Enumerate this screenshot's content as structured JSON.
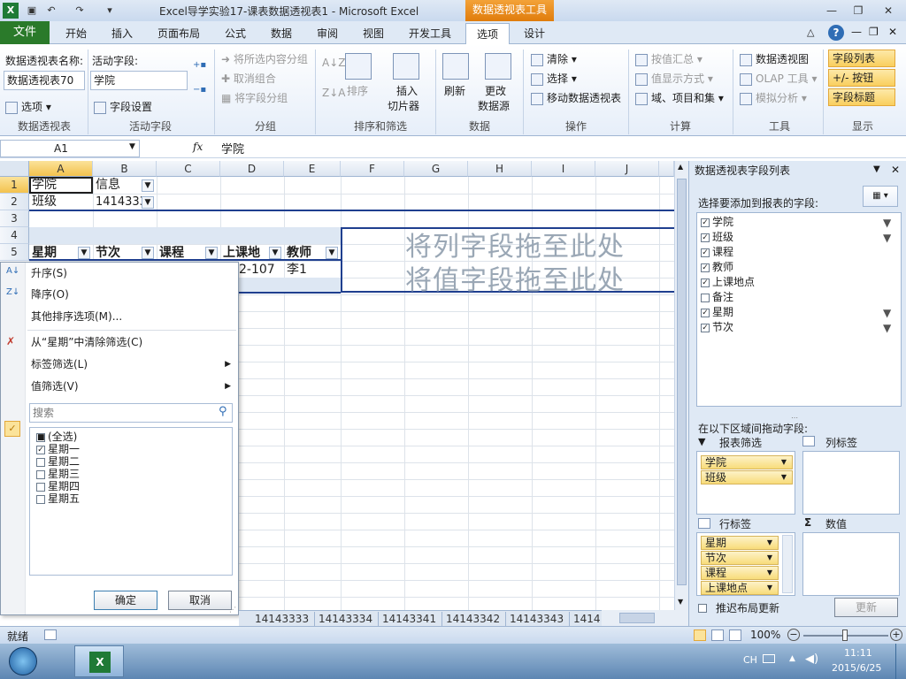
{
  "window": {
    "title": "Excel导学实验17-课表数据透视表1  -  Microsoft Excel",
    "context_tab_header": "数据透视表工具"
  },
  "tabs": {
    "file": "文件",
    "items": [
      "开始",
      "插入",
      "页面布局",
      "公式",
      "数据",
      "审阅",
      "视图",
      "开发工具",
      "选项",
      "设计"
    ]
  },
  "ribbon": {
    "pivot": {
      "name_label": "数据透视表名称:",
      "name_value": "数据透视表70",
      "options_btn": "选项",
      "group": "数据透视表"
    },
    "active_field": {
      "label": "活动字段:",
      "value": "学院",
      "settings_btn": "字段设置",
      "group": "活动字段"
    },
    "grouping": {
      "items": [
        "将所选内容分组",
        "取消组合",
        "将字段分组"
      ],
      "group": "分组"
    },
    "sort": {
      "sort_btn": "排序",
      "insert_slicer": "插入",
      "insert_slicer2": "切片器",
      "group": "排序和筛选"
    },
    "data": {
      "refresh": "刷新",
      "change_source": "更改",
      "change_source2": "数据源",
      "group": "数据"
    },
    "actions": {
      "clear": "清除",
      "select": "选择",
      "move": "移动数据透视表",
      "group": "操作"
    },
    "calc": {
      "summarize": "按值汇总",
      "show_as": "值显示方式",
      "fields_items": "域、项目和集",
      "group": "计算"
    },
    "tools": {
      "pivot_chart": "数据透视图",
      "olap": "OLAP 工具",
      "whatif": "模拟分析",
      "group": "工具"
    },
    "show": {
      "field_list": "字段列表",
      "buttons": "+/- 按钮",
      "headers": "字段标题",
      "group": "显示"
    }
  },
  "formula_bar": {
    "name_box": "A1",
    "fx": "fx",
    "content": "学院"
  },
  "grid": {
    "columns": [
      "A",
      "B",
      "C",
      "D",
      "E",
      "F",
      "G",
      "H",
      "I",
      "J"
    ],
    "rows": [
      "1",
      "2",
      "3",
      "4",
      "5"
    ],
    "cells": {
      "A1": "学院",
      "B1": "信息",
      "A2": "班级",
      "B2": "14143333",
      "A5": "星期",
      "B5": "节次",
      "C5": "课程",
      "D5": "上课地",
      "E5": "教师",
      "D6": "2-107",
      "E6": "李1"
    },
    "watermark_col": "将列字段拖至此处",
    "watermark_val": "将值字段拖至此处"
  },
  "filter_menu": {
    "sort_asc": "升序(S)",
    "sort_desc": "降序(O)",
    "more_sort": "其他排序选项(M)...",
    "clear_filter": "从“星期”中清除筛选(C)",
    "label_filter": "标签筛选(L)",
    "value_filter": "值筛选(V)",
    "search_placeholder": "搜索",
    "items": [
      {
        "label": "(全选)",
        "state": "mixed"
      },
      {
        "label": "星期一",
        "state": "checked"
      },
      {
        "label": "星期二",
        "state": "unchecked"
      },
      {
        "label": "星期三",
        "state": "unchecked"
      },
      {
        "label": "星期四",
        "state": "unchecked"
      },
      {
        "label": "星期五",
        "state": "unchecked"
      }
    ],
    "ok": "确定",
    "cancel": "取消"
  },
  "sheet_tabs": [
    "14143333",
    "14143334",
    "14143341",
    "14143342",
    "14143343",
    "1414"
  ],
  "status": {
    "ready": "就绪",
    "zoom": "100%"
  },
  "pane": {
    "title": "数据透视表字段列表",
    "choose_label": "选择要添加到报表的字段:",
    "fields": [
      {
        "label": "学院",
        "checked": true,
        "filtered": true
      },
      {
        "label": "班级",
        "checked": true,
        "filtered": true
      },
      {
        "label": "课程",
        "checked": true,
        "filtered": false
      },
      {
        "label": "教师",
        "checked": true,
        "filtered": false
      },
      {
        "label": "上课地点",
        "checked": true,
        "filtered": false
      },
      {
        "label": "备注",
        "checked": false,
        "filtered": false
      },
      {
        "label": "星期",
        "checked": true,
        "filtered": true
      },
      {
        "label": "节次",
        "checked": true,
        "filtered": true
      }
    ],
    "drag_label": "在以下区域间拖动字段:",
    "report_filter": "报表筛选",
    "column_labels": "列标签",
    "row_labels": "行标签",
    "values": "数值",
    "filter_chips": [
      "学院",
      "班级"
    ],
    "row_chips": [
      "星期",
      "节次",
      "课程",
      "上课地点"
    ],
    "defer_label": "推迟布局更新",
    "update_btn": "更新"
  },
  "taskbar": {
    "lang": "CH",
    "time": "11:11",
    "date": "2015/6/25"
  },
  "colors": {
    "file_tab": "#2a7a2a",
    "context_tab": "#e07c0c",
    "selected_header": "#f3c24e",
    "pivot_border": "#1f3f8f"
  }
}
